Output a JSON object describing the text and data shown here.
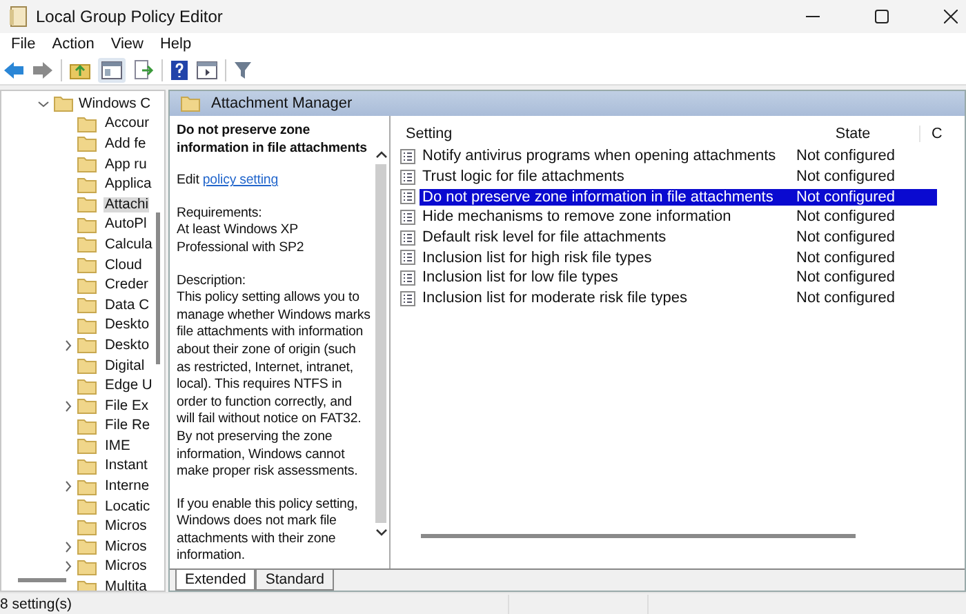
{
  "window": {
    "title": "Local Group Policy Editor"
  },
  "menu": [
    "File",
    "Action",
    "View",
    "Help"
  ],
  "tree": {
    "label": "Windows C",
    "expanded": true,
    "children": [
      {
        "label": "Accour",
        "kind": "leaf",
        "selected": false
      },
      {
        "label": "Add fe",
        "kind": "leaf",
        "selected": false
      },
      {
        "label": "App ru",
        "kind": "leaf",
        "selected": false
      },
      {
        "label": "Applica",
        "kind": "leaf",
        "selected": false
      },
      {
        "label": "Attachi",
        "kind": "leaf",
        "selected": true
      },
      {
        "label": "AutoPl",
        "kind": "leaf",
        "selected": false
      },
      {
        "label": "Calcula",
        "kind": "leaf",
        "selected": false
      },
      {
        "label": "Cloud",
        "kind": "leaf",
        "selected": false
      },
      {
        "label": "Creder",
        "kind": "leaf",
        "selected": false
      },
      {
        "label": "Data C",
        "kind": "leaf",
        "selected": false
      },
      {
        "label": "Deskto",
        "kind": "leaf",
        "selected": false
      },
      {
        "label": "Deskto",
        "kind": "collapsed",
        "selected": false
      },
      {
        "label": "Digital",
        "kind": "leaf",
        "selected": false
      },
      {
        "label": "Edge U",
        "kind": "leaf",
        "selected": false
      },
      {
        "label": "File Ex",
        "kind": "collapsed",
        "selected": false
      },
      {
        "label": "File Re",
        "kind": "leaf",
        "selected": false
      },
      {
        "label": "IME",
        "kind": "leaf",
        "selected": false
      },
      {
        "label": "Instant",
        "kind": "leaf",
        "selected": false
      },
      {
        "label": "Interne",
        "kind": "collapsed",
        "selected": false
      },
      {
        "label": "Locatic",
        "kind": "leaf",
        "selected": false
      },
      {
        "label": "Micros",
        "kind": "leaf",
        "selected": false
      },
      {
        "label": "Micros",
        "kind": "collapsed",
        "selected": false
      },
      {
        "label": "Micros",
        "kind": "collapsed",
        "selected": false
      },
      {
        "label": "Multita",
        "kind": "leaf",
        "selected": false
      }
    ]
  },
  "header": {
    "title": "Attachment Manager"
  },
  "description": {
    "title": "Do not preserve zone information in file attachments",
    "edit_prefix": "Edit",
    "edit_link": "policy setting",
    "requirements_label": "Requirements:",
    "requirements": "At least Windows XP Professional with SP2",
    "description_label": "Description:",
    "paragraphs": [
      "This policy setting allows you to manage whether Windows marks file attachments with information about their zone of origin (such as restricted, Internet, intranet, local). This requires NTFS in order to function correctly, and will fail without notice on FAT32. By not preserving the zone information, Windows cannot make proper risk assessments.",
      "If you enable this policy setting, Windows does not mark file attachments with their zone information."
    ]
  },
  "table": {
    "columns": [
      "Setting",
      "State",
      "C"
    ],
    "rows": [
      {
        "setting": "Notify antivirus programs when opening attachments",
        "state": "Not configured",
        "selected": false
      },
      {
        "setting": "Trust logic for file attachments",
        "state": "Not configured",
        "selected": false
      },
      {
        "setting": "Do not preserve zone information in file attachments",
        "state": "Not configured",
        "selected": true
      },
      {
        "setting": "Hide mechanisms to remove zone information",
        "state": "Not configured",
        "selected": false
      },
      {
        "setting": "Default risk level for file attachments",
        "state": "Not configured",
        "selected": false
      },
      {
        "setting": "Inclusion list for high risk file types",
        "state": "Not configured",
        "selected": false
      },
      {
        "setting": "Inclusion list for low file types",
        "state": "Not configured",
        "selected": false
      },
      {
        "setting": "Inclusion list for moderate risk file types",
        "state": "Not configured",
        "selected": false
      }
    ]
  },
  "view_tabs": [
    {
      "label": "Extended",
      "selected": true
    },
    {
      "label": "Standard",
      "selected": false
    }
  ],
  "status_bar": "8 setting(s)"
}
